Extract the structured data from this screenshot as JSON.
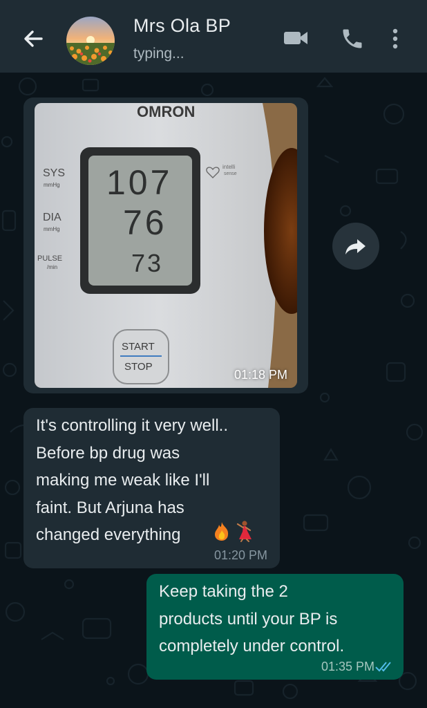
{
  "header": {
    "contact_name": "Mrs Ola BP",
    "status": "typing...",
    "icons": [
      "back-arrow-icon",
      "video-call-icon",
      "phone-icon",
      "more-options-icon"
    ]
  },
  "colors": {
    "header_bg": "#1f2c34",
    "chat_bg": "#0b141a",
    "incoming_bubble": "#1f2c34",
    "outgoing_bubble": "#005c4b",
    "read_ticks": "#53bdeb"
  },
  "messages": [
    {
      "direction": "incoming",
      "type": "image",
      "image_text": {
        "brand": "OMRON",
        "sys_label": "SYS",
        "sys_unit": "mmHg",
        "dia_label": "DIA",
        "dia_unit": "mmHg",
        "pulse_label": "PULSE",
        "pulse_unit": "/min",
        "sys_value": "107",
        "dia_value": "76",
        "pulse_value": "73",
        "badge_line1": "intelli",
        "badge_line2": "sense",
        "button_top": "START",
        "button_bottom": "STOP"
      },
      "time": "01:18 PM"
    },
    {
      "direction": "incoming",
      "type": "text",
      "text": "It's controlling it very well..\nBefore bp drug was\nmaking me weak like I'll\nfaint. But Arjuna has\nchanged everything",
      "emojis": [
        "fire-emoji",
        "dancer-emoji"
      ],
      "time": "01:20 PM"
    },
    {
      "direction": "outgoing",
      "type": "text",
      "text": "Keep taking the 2\nproducts until your BP is\ncompletely under control.",
      "time": "01:35 PM",
      "status": "read"
    }
  ]
}
